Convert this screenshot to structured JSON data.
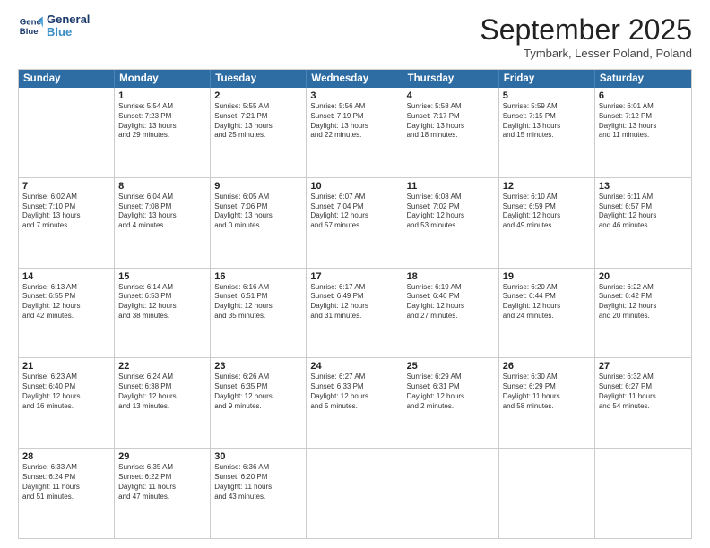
{
  "header": {
    "logo_line1": "General",
    "logo_line2": "Blue",
    "month": "September 2025",
    "location": "Tymbark, Lesser Poland, Poland"
  },
  "day_headers": [
    "Sunday",
    "Monday",
    "Tuesday",
    "Wednesday",
    "Thursday",
    "Friday",
    "Saturday"
  ],
  "weeks": [
    [
      {
        "day": "",
        "lines": []
      },
      {
        "day": "1",
        "lines": [
          "Sunrise: 5:54 AM",
          "Sunset: 7:23 PM",
          "Daylight: 13 hours",
          "and 29 minutes."
        ]
      },
      {
        "day": "2",
        "lines": [
          "Sunrise: 5:55 AM",
          "Sunset: 7:21 PM",
          "Daylight: 13 hours",
          "and 25 minutes."
        ]
      },
      {
        "day": "3",
        "lines": [
          "Sunrise: 5:56 AM",
          "Sunset: 7:19 PM",
          "Daylight: 13 hours",
          "and 22 minutes."
        ]
      },
      {
        "day": "4",
        "lines": [
          "Sunrise: 5:58 AM",
          "Sunset: 7:17 PM",
          "Daylight: 13 hours",
          "and 18 minutes."
        ]
      },
      {
        "day": "5",
        "lines": [
          "Sunrise: 5:59 AM",
          "Sunset: 7:15 PM",
          "Daylight: 13 hours",
          "and 15 minutes."
        ]
      },
      {
        "day": "6",
        "lines": [
          "Sunrise: 6:01 AM",
          "Sunset: 7:12 PM",
          "Daylight: 13 hours",
          "and 11 minutes."
        ]
      }
    ],
    [
      {
        "day": "7",
        "lines": [
          "Sunrise: 6:02 AM",
          "Sunset: 7:10 PM",
          "Daylight: 13 hours",
          "and 7 minutes."
        ]
      },
      {
        "day": "8",
        "lines": [
          "Sunrise: 6:04 AM",
          "Sunset: 7:08 PM",
          "Daylight: 13 hours",
          "and 4 minutes."
        ]
      },
      {
        "day": "9",
        "lines": [
          "Sunrise: 6:05 AM",
          "Sunset: 7:06 PM",
          "Daylight: 13 hours",
          "and 0 minutes."
        ]
      },
      {
        "day": "10",
        "lines": [
          "Sunrise: 6:07 AM",
          "Sunset: 7:04 PM",
          "Daylight: 12 hours",
          "and 57 minutes."
        ]
      },
      {
        "day": "11",
        "lines": [
          "Sunrise: 6:08 AM",
          "Sunset: 7:02 PM",
          "Daylight: 12 hours",
          "and 53 minutes."
        ]
      },
      {
        "day": "12",
        "lines": [
          "Sunrise: 6:10 AM",
          "Sunset: 6:59 PM",
          "Daylight: 12 hours",
          "and 49 minutes."
        ]
      },
      {
        "day": "13",
        "lines": [
          "Sunrise: 6:11 AM",
          "Sunset: 6:57 PM",
          "Daylight: 12 hours",
          "and 46 minutes."
        ]
      }
    ],
    [
      {
        "day": "14",
        "lines": [
          "Sunrise: 6:13 AM",
          "Sunset: 6:55 PM",
          "Daylight: 12 hours",
          "and 42 minutes."
        ]
      },
      {
        "day": "15",
        "lines": [
          "Sunrise: 6:14 AM",
          "Sunset: 6:53 PM",
          "Daylight: 12 hours",
          "and 38 minutes."
        ]
      },
      {
        "day": "16",
        "lines": [
          "Sunrise: 6:16 AM",
          "Sunset: 6:51 PM",
          "Daylight: 12 hours",
          "and 35 minutes."
        ]
      },
      {
        "day": "17",
        "lines": [
          "Sunrise: 6:17 AM",
          "Sunset: 6:49 PM",
          "Daylight: 12 hours",
          "and 31 minutes."
        ]
      },
      {
        "day": "18",
        "lines": [
          "Sunrise: 6:19 AM",
          "Sunset: 6:46 PM",
          "Daylight: 12 hours",
          "and 27 minutes."
        ]
      },
      {
        "day": "19",
        "lines": [
          "Sunrise: 6:20 AM",
          "Sunset: 6:44 PM",
          "Daylight: 12 hours",
          "and 24 minutes."
        ]
      },
      {
        "day": "20",
        "lines": [
          "Sunrise: 6:22 AM",
          "Sunset: 6:42 PM",
          "Daylight: 12 hours",
          "and 20 minutes."
        ]
      }
    ],
    [
      {
        "day": "21",
        "lines": [
          "Sunrise: 6:23 AM",
          "Sunset: 6:40 PM",
          "Daylight: 12 hours",
          "and 16 minutes."
        ]
      },
      {
        "day": "22",
        "lines": [
          "Sunrise: 6:24 AM",
          "Sunset: 6:38 PM",
          "Daylight: 12 hours",
          "and 13 minutes."
        ]
      },
      {
        "day": "23",
        "lines": [
          "Sunrise: 6:26 AM",
          "Sunset: 6:35 PM",
          "Daylight: 12 hours",
          "and 9 minutes."
        ]
      },
      {
        "day": "24",
        "lines": [
          "Sunrise: 6:27 AM",
          "Sunset: 6:33 PM",
          "Daylight: 12 hours",
          "and 5 minutes."
        ]
      },
      {
        "day": "25",
        "lines": [
          "Sunrise: 6:29 AM",
          "Sunset: 6:31 PM",
          "Daylight: 12 hours",
          "and 2 minutes."
        ]
      },
      {
        "day": "26",
        "lines": [
          "Sunrise: 6:30 AM",
          "Sunset: 6:29 PM",
          "Daylight: 11 hours",
          "and 58 minutes."
        ]
      },
      {
        "day": "27",
        "lines": [
          "Sunrise: 6:32 AM",
          "Sunset: 6:27 PM",
          "Daylight: 11 hours",
          "and 54 minutes."
        ]
      }
    ],
    [
      {
        "day": "28",
        "lines": [
          "Sunrise: 6:33 AM",
          "Sunset: 6:24 PM",
          "Daylight: 11 hours",
          "and 51 minutes."
        ]
      },
      {
        "day": "29",
        "lines": [
          "Sunrise: 6:35 AM",
          "Sunset: 6:22 PM",
          "Daylight: 11 hours",
          "and 47 minutes."
        ]
      },
      {
        "day": "30",
        "lines": [
          "Sunrise: 6:36 AM",
          "Sunset: 6:20 PM",
          "Daylight: 11 hours",
          "and 43 minutes."
        ]
      },
      {
        "day": "",
        "lines": []
      },
      {
        "day": "",
        "lines": []
      },
      {
        "day": "",
        "lines": []
      },
      {
        "day": "",
        "lines": []
      }
    ]
  ]
}
